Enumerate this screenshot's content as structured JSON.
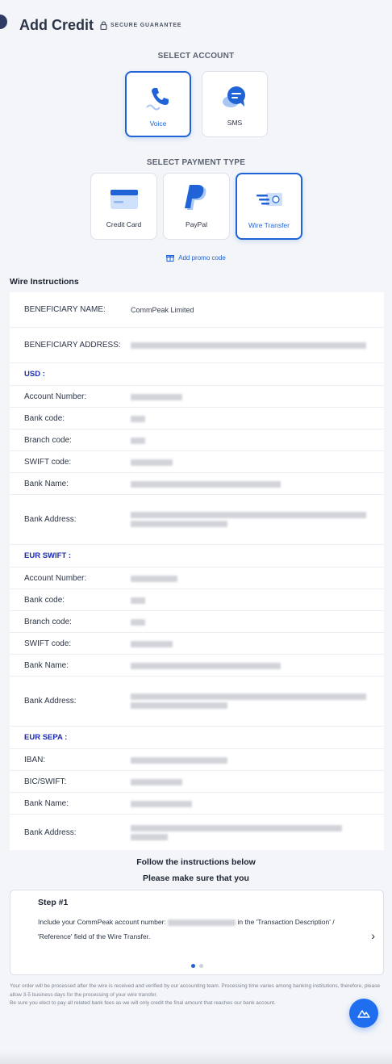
{
  "header": {
    "title": "Add Credit",
    "secure": "SECURE GUARANTEE"
  },
  "select_account": {
    "label": "SELECT ACCOUNT",
    "options": [
      {
        "label": "Voice",
        "icon": "phone-icon",
        "selected": true
      },
      {
        "label": "SMS",
        "icon": "chat-bubble-icon",
        "selected": false
      }
    ]
  },
  "payment_type": {
    "label": "SELECT PAYMENT TYPE",
    "options": [
      {
        "label": "Credit Card",
        "icon": "credit-card-icon",
        "selected": false
      },
      {
        "label": "PayPal",
        "icon": "paypal-icon",
        "selected": false
      },
      {
        "label": "Wire Transfer",
        "icon": "wire-transfer-icon",
        "selected": true
      }
    ]
  },
  "promo": {
    "label": "Add promo code",
    "icon": "gift-icon"
  },
  "wire": {
    "title": "Wire Instructions",
    "beneficiary_name_label": "BENEFICIARY NAME:",
    "beneficiary_name": "CommPeak Limited",
    "beneficiary_address_label": "BENEFICIARY ADDRESS:",
    "usd_label": "USD :",
    "eur_swift_label": "EUR SWIFT :",
    "eur_sepa_label": "EUR SEPA :",
    "labels": {
      "account_number": "Account Number:",
      "bank_code": "Bank code:",
      "branch_code": "Branch code:",
      "swift_code": "SWIFT code:",
      "bank_name": "Bank Name:",
      "bank_address": "Bank Address:",
      "iban": "IBAN:",
      "bic_swift": "BIC/SWIFT:"
    }
  },
  "instructions": {
    "line1": "Follow the instructions below",
    "line2": "Please make sure that you"
  },
  "step": {
    "title": "Step #1",
    "text_before": "Include your CommPeak account number:",
    "text_after": "in the 'Transaction Description' / 'Reference' field of the Wire Transfer.",
    "current": 1,
    "total": 2
  },
  "footer": {
    "line1": "Your order will be processed after the wire is received and verified by our accounting team. Processing time varies among banking institutions, therefore, please allow 3-5 business days for the processing of your wire transfer.",
    "line2": "Be sure you elect to pay all related bank fees as we will only credit the final amount that reaches our bank account."
  },
  "colors": {
    "accent": "#1f63d6",
    "section": "#1b2bb0",
    "background": "#f3f5f8"
  }
}
